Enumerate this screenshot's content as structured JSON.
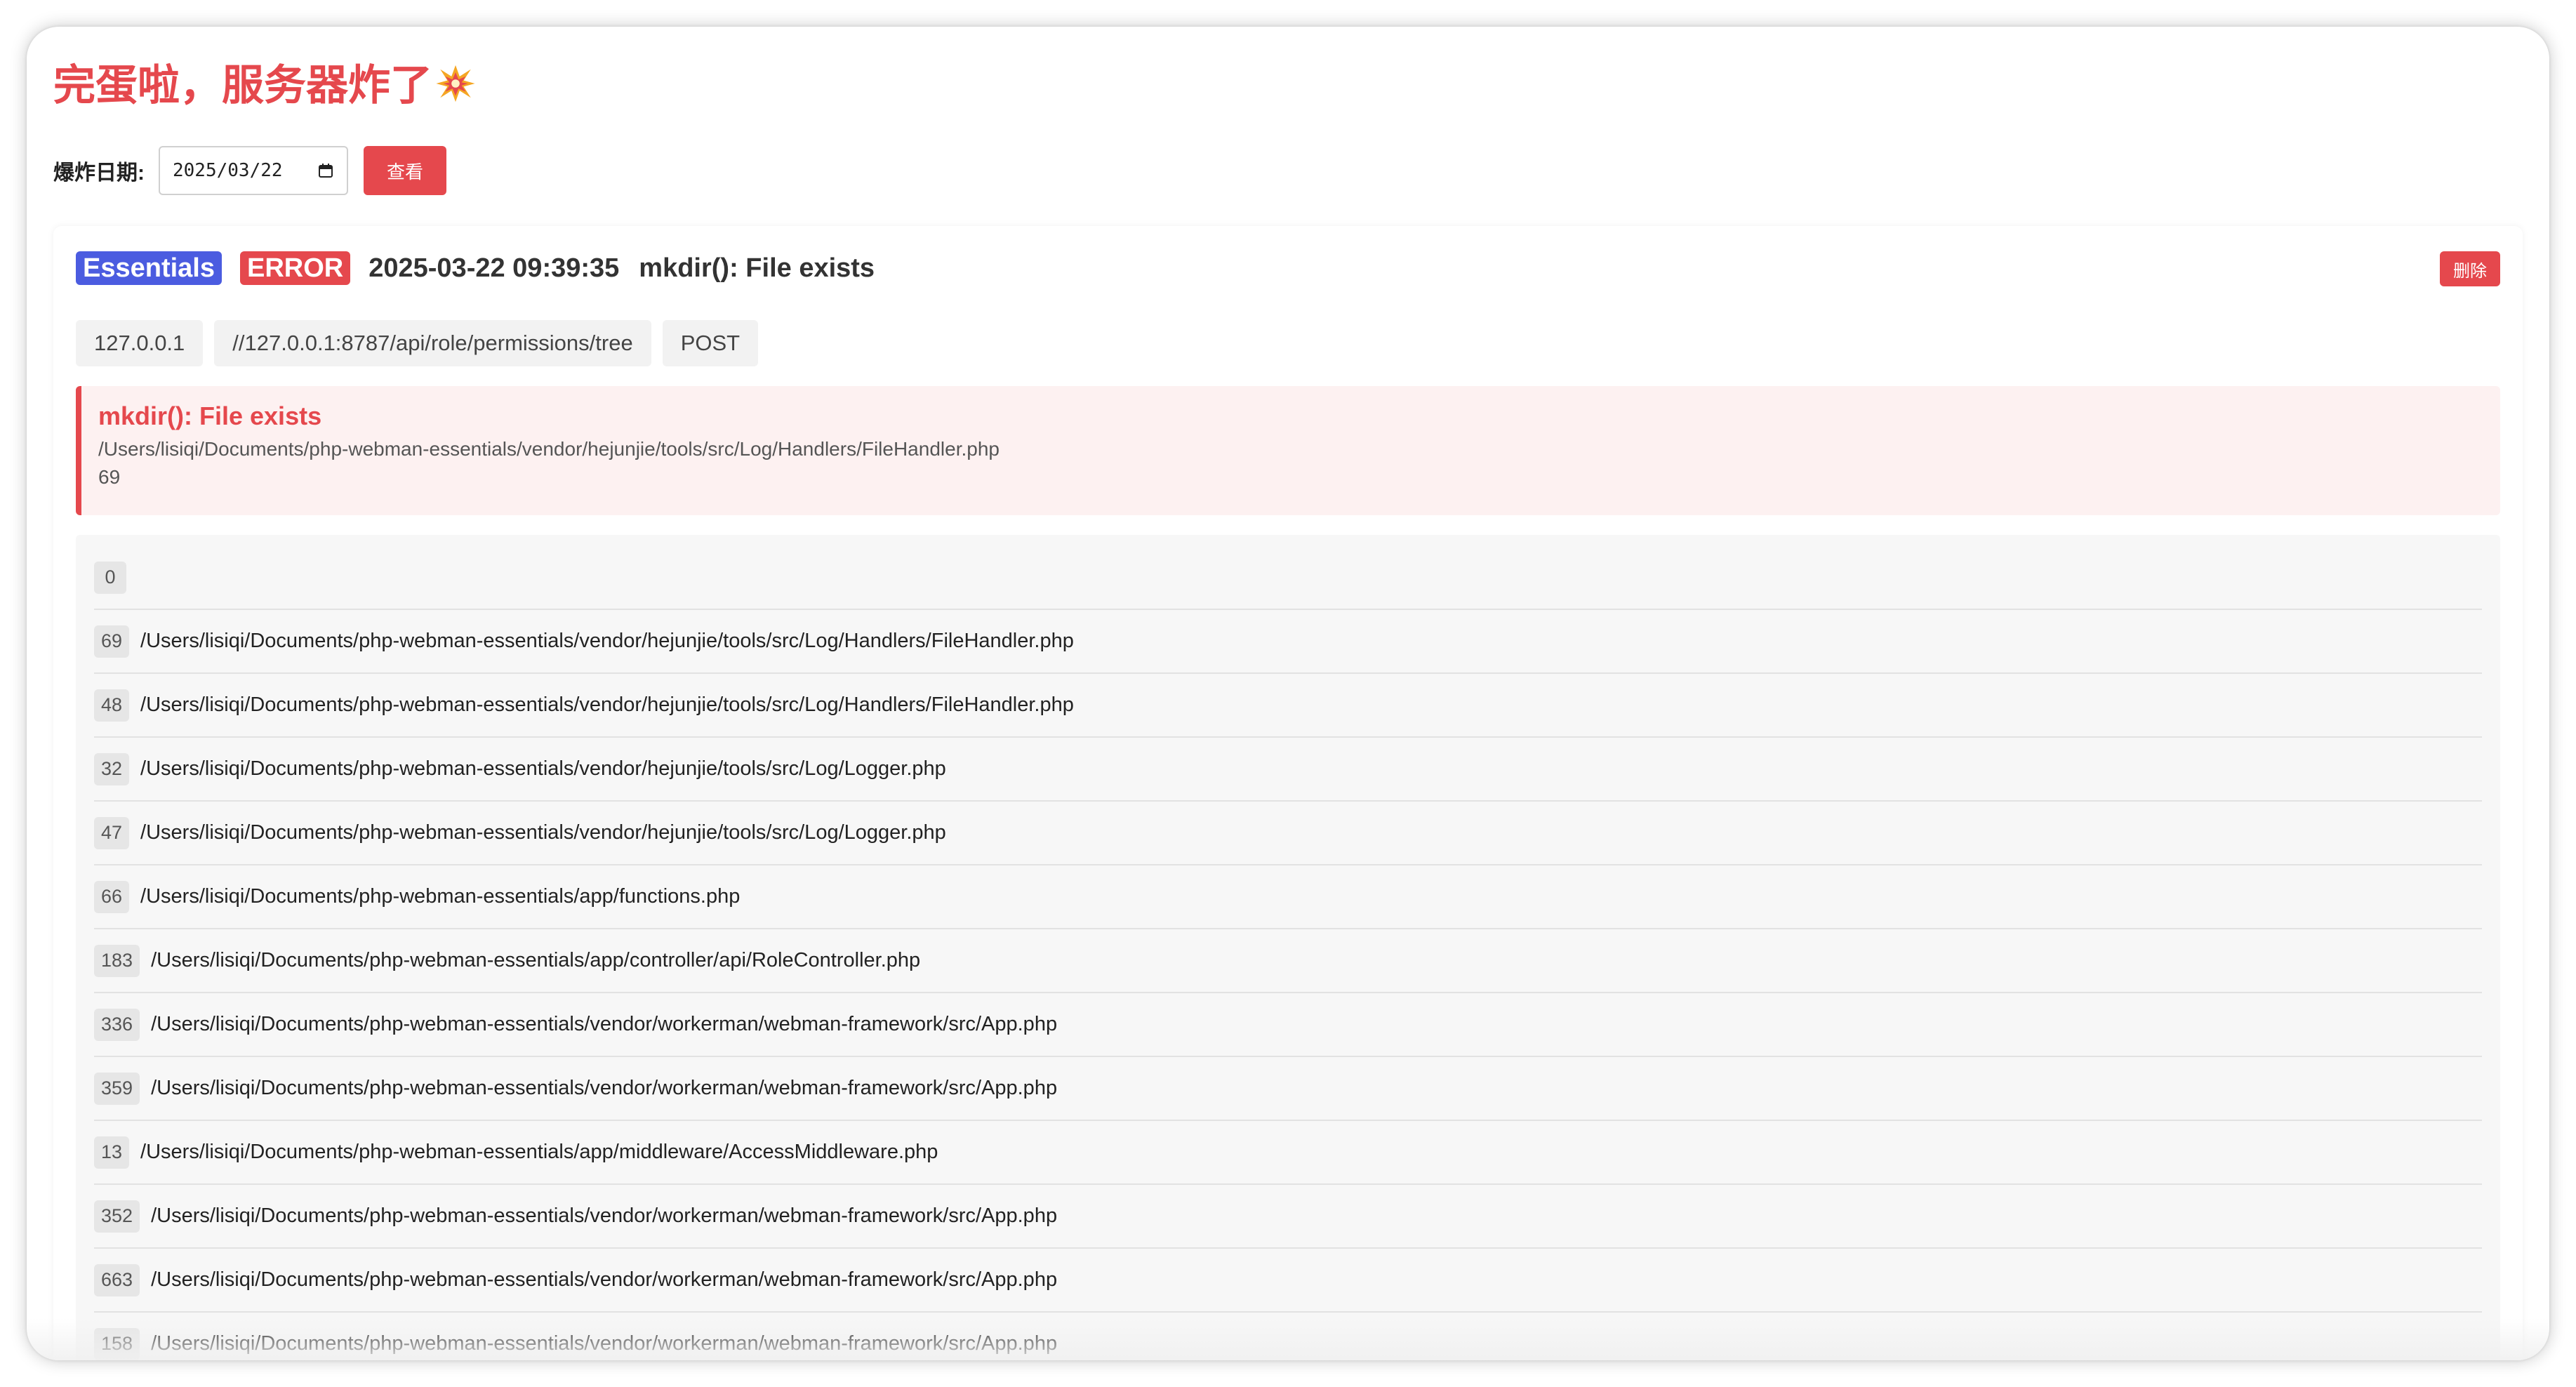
{
  "page": {
    "title": "完蛋啦，服务器炸了",
    "title_icon": "collision-icon"
  },
  "toolbar": {
    "date_label": "爆炸日期:",
    "date_value": "2025/03/22",
    "view_label": "查看"
  },
  "log": {
    "app_badge": "Essentials",
    "level_badge": "ERROR",
    "time": "2025-03-22 09:39:35",
    "message": "mkdir(): File exists",
    "delete_label": "删除",
    "ip": "127.0.0.1",
    "url": "//127.0.0.1:8787/api/role/permissions/tree",
    "method": "POST",
    "error": {
      "title": "mkdir(): File exists",
      "file": "/Users/lisiqi/Documents/php-webman-essentials/vendor/hejunjie/tools/src/Log/Handlers/FileHandler.php",
      "line": "69"
    },
    "trace": [
      {
        "line": "0",
        "path": ""
      },
      {
        "line": "69",
        "path": "/Users/lisiqi/Documents/php-webman-essentials/vendor/hejunjie/tools/src/Log/Handlers/FileHandler.php"
      },
      {
        "line": "48",
        "path": "/Users/lisiqi/Documents/php-webman-essentials/vendor/hejunjie/tools/src/Log/Handlers/FileHandler.php"
      },
      {
        "line": "32",
        "path": "/Users/lisiqi/Documents/php-webman-essentials/vendor/hejunjie/tools/src/Log/Logger.php"
      },
      {
        "line": "47",
        "path": "/Users/lisiqi/Documents/php-webman-essentials/vendor/hejunjie/tools/src/Log/Logger.php"
      },
      {
        "line": "66",
        "path": "/Users/lisiqi/Documents/php-webman-essentials/app/functions.php"
      },
      {
        "line": "183",
        "path": "/Users/lisiqi/Documents/php-webman-essentials/app/controller/api/RoleController.php"
      },
      {
        "line": "336",
        "path": "/Users/lisiqi/Documents/php-webman-essentials/vendor/workerman/webman-framework/src/App.php"
      },
      {
        "line": "359",
        "path": "/Users/lisiqi/Documents/php-webman-essentials/vendor/workerman/webman-framework/src/App.php"
      },
      {
        "line": "13",
        "path": "/Users/lisiqi/Documents/php-webman-essentials/app/middleware/AccessMiddleware.php"
      },
      {
        "line": "352",
        "path": "/Users/lisiqi/Documents/php-webman-essentials/vendor/workerman/webman-framework/src/App.php"
      },
      {
        "line": "663",
        "path": "/Users/lisiqi/Documents/php-webman-essentials/vendor/workerman/webman-framework/src/App.php"
      },
      {
        "line": "158",
        "path": "/Users/lisiqi/Documents/php-webman-essentials/vendor/workerman/webman-framework/src/App.php"
      }
    ]
  },
  "colors": {
    "accent": "#e5484d",
    "app_badge": "#4b5ce0"
  }
}
